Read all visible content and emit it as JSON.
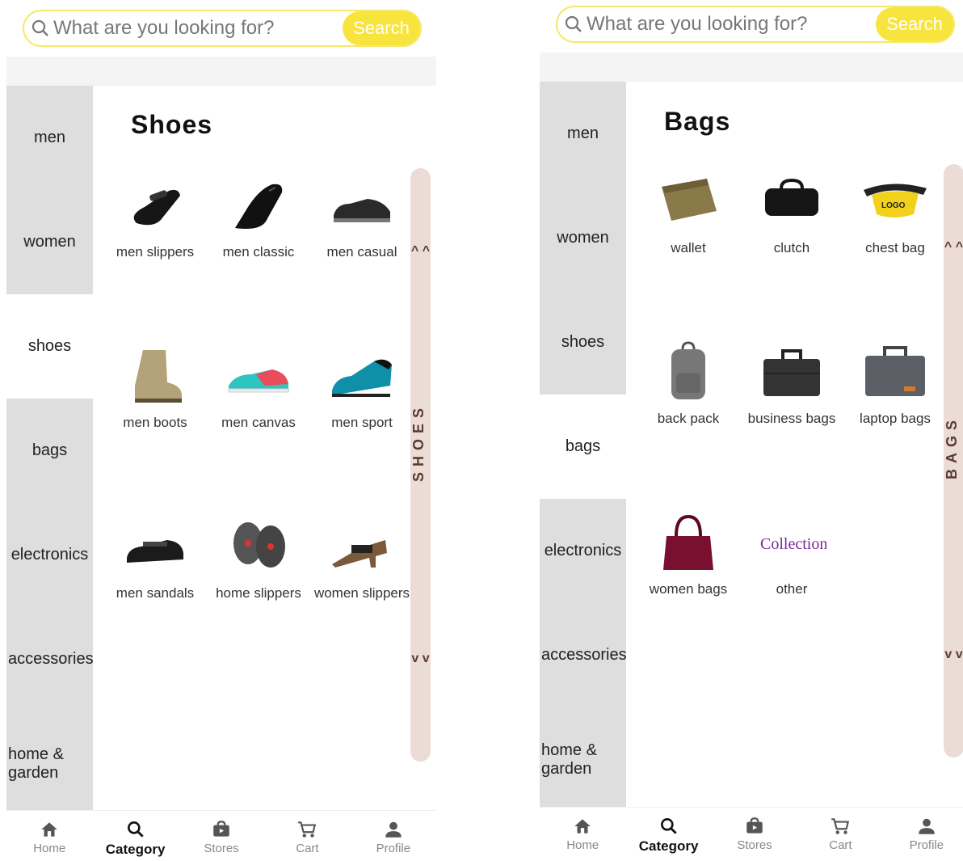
{
  "search": {
    "placeholder": "What are you looking for?",
    "button": "Search"
  },
  "sidebar": [
    "men",
    "women",
    "shoes",
    "bags",
    "electronics",
    "accessories",
    "home & garden"
  ],
  "nav": [
    "Home",
    "Category",
    "Stores",
    "Cart",
    "Profile"
  ],
  "screens": [
    {
      "title": "Shoes",
      "rail_label": "SHOES",
      "rail_up": "^ ^",
      "rail_down": "v v",
      "active_category": "shoes",
      "active_nav": "Category",
      "items": [
        [
          "men slippers",
          "men classic",
          "men casual"
        ],
        [
          "men boots",
          "men canvas",
          "men sport"
        ],
        [
          "men sandals",
          "home slippers",
          "women slippers"
        ]
      ]
    },
    {
      "title": "Bags",
      "rail_label": "BAGS",
      "rail_up": "^ ^",
      "rail_down": "v v",
      "active_category": "bags",
      "active_nav": "Category",
      "items": [
        [
          "wallet",
          "clutch",
          "chest bag"
        ],
        [
          "back pack",
          "business bags",
          "laptop bags"
        ],
        [
          "women bags",
          "other"
        ]
      ],
      "other_logo_text": "Collection"
    }
  ],
  "colors": {
    "accent": "#f7e43d",
    "rail": "#ecdcd6",
    "sidebar": "#dedede"
  }
}
